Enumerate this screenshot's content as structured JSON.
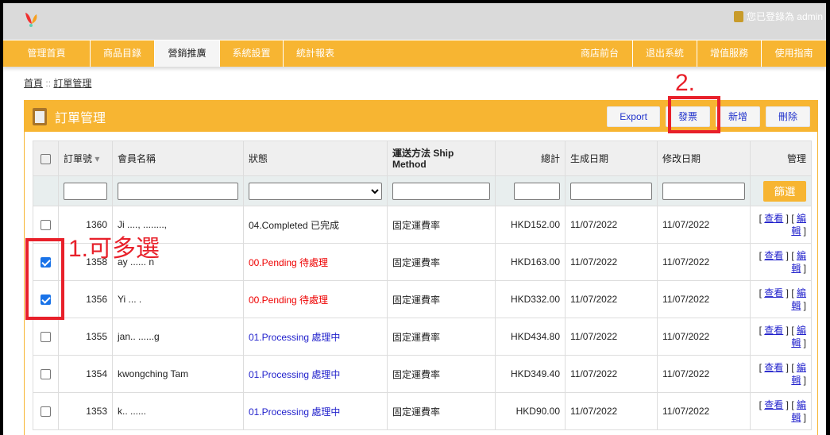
{
  "header": {
    "login_text": "您已登錄為 admin"
  },
  "nav": {
    "left": [
      "管理首頁",
      "商品目錄",
      "營銷推廣",
      "系統設置",
      "統計報表"
    ],
    "active": "營銷推廣",
    "right": [
      "商店前台",
      "退出系統",
      "增值服務",
      "使用指南"
    ]
  },
  "breadcrumb": {
    "home": "首頁",
    "sep": "::",
    "current": "訂單管理"
  },
  "panel": {
    "title": "訂單管理",
    "buttons": {
      "export": "Export",
      "invoice": "發票",
      "add": "新增",
      "delete": "刪除"
    }
  },
  "table": {
    "headers": {
      "order_no": "訂單號",
      "member": "會員名稱",
      "status": "狀態",
      "ship": "運送方法 Ship Method",
      "total": "總計",
      "created": "生成日期",
      "modified": "修改日期",
      "manage": "管理"
    },
    "filter_button": "篩選",
    "view_label": "查看",
    "edit_label": "編輯",
    "rows": [
      {
        "checked": false,
        "id": "1360",
        "name": "Ji ...., ........,",
        "status": "04.Completed 已完成",
        "status_type": "completed",
        "ship": "固定運費率",
        "total": "HKD152.00",
        "created": "11/07/2022",
        "modified": "11/07/2022"
      },
      {
        "checked": true,
        "id": "1358",
        "name": "ay ...... n",
        "status": "00.Pending 待處理",
        "status_type": "pending",
        "ship": "固定運費率",
        "total": "HKD163.00",
        "created": "11/07/2022",
        "modified": "11/07/2022"
      },
      {
        "checked": true,
        "id": "1356",
        "name": "Yi  ...  .",
        "status": "00.Pending 待處理",
        "status_type": "pending",
        "ship": "固定運費率",
        "total": "HKD332.00",
        "created": "11/07/2022",
        "modified": "11/07/2022"
      },
      {
        "checked": false,
        "id": "1355",
        "name": "jan..  ......g",
        "status": "01.Processing 處理中",
        "status_type": "processing",
        "ship": "固定運費率",
        "total": "HKD434.80",
        "created": "11/07/2022",
        "modified": "11/07/2022"
      },
      {
        "checked": false,
        "id": "1354",
        "name": "kwongching Tam",
        "status": "01.Processing 處理中",
        "status_type": "processing",
        "ship": "固定運費率",
        "total": "HKD349.40",
        "created": "11/07/2022",
        "modified": "11/07/2022"
      },
      {
        "checked": false,
        "id": "1353",
        "name": "k.. ......",
        "status": "01.Processing 處理中",
        "status_type": "processing",
        "ship": "固定運費率",
        "total": "HKD90.00",
        "created": "11/07/2022",
        "modified": "11/07/2022"
      }
    ]
  },
  "annotations": {
    "step1": "1.可多選",
    "step2": "2."
  }
}
